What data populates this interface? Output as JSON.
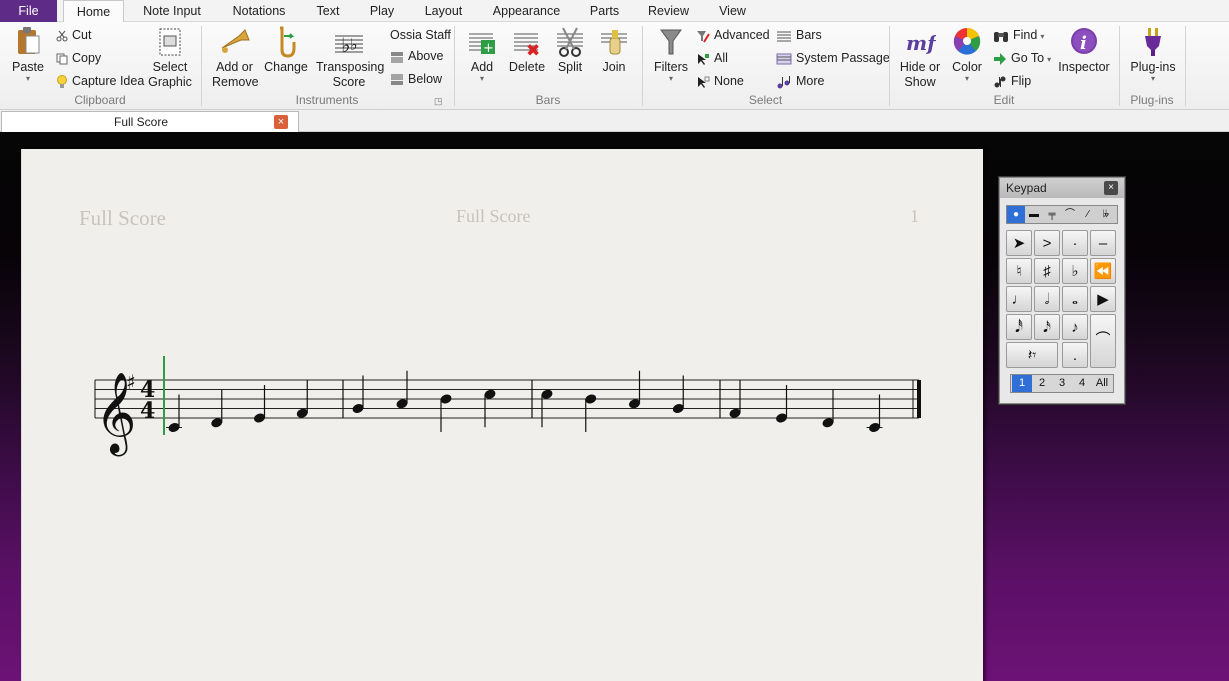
{
  "menu_tabs": [
    "File",
    "Home",
    "Note Input",
    "Notations",
    "Text",
    "Play",
    "Layout",
    "Appearance",
    "Parts",
    "Review",
    "View"
  ],
  "active_tab": "Home",
  "ribbon": {
    "clipboard": {
      "group_label": "Clipboard",
      "paste": "Paste",
      "cut": "Cut",
      "copy": "Copy",
      "capture_idea": "Capture Idea",
      "select_graphic": "Select Graphic"
    },
    "instruments": {
      "group_label": "Instruments",
      "add_or_remove": "Add or Remove",
      "change": "Change",
      "transposing_score": "Transposing Score",
      "ossia_staff": "Ossia Staff",
      "above": "Above",
      "below": "Below"
    },
    "bars": {
      "group_label": "Bars",
      "add": "Add",
      "delete": "Delete",
      "split": "Split",
      "join": "Join"
    },
    "select": {
      "group_label": "Select",
      "filters": "Filters",
      "advanced": "Advanced",
      "all": "All",
      "none": "None",
      "bars": "Bars",
      "system_passage": "System Passage",
      "more": "More"
    },
    "edit": {
      "group_label": "Edit",
      "hide_or_show": "Hide or Show",
      "color": "Color",
      "find": "Find",
      "go_to": "Go To",
      "flip": "Flip",
      "inspector": "Inspector"
    },
    "plugins": {
      "group_label": "Plug-ins",
      "plugins": "Plug-ins"
    }
  },
  "document_tab": {
    "label": "Full Score",
    "close": "×"
  },
  "score": {
    "header_left": "Full Score",
    "header_center": "Full Score",
    "page_number": "1",
    "clef": "treble",
    "key_signature": "G major (1 sharp)",
    "time_signature": "4/4",
    "bars": [
      {
        "notes": [
          "C4",
          "D4",
          "E4",
          "F#4"
        ]
      },
      {
        "notes": [
          "G4",
          "A4",
          "B4",
          "C5"
        ]
      },
      {
        "notes": [
          "C5",
          "B4",
          "A4",
          "G4"
        ]
      },
      {
        "notes": [
          "F#4",
          "E4",
          "D4",
          "C4"
        ]
      }
    ],
    "note_value": "quarter"
  },
  "keypad": {
    "title": "Keypad",
    "close": "×",
    "layouts": [
      "1",
      "2",
      "3",
      "4",
      "All"
    ],
    "active_layout": "1",
    "keys_row1": [
      "pointer",
      ">",
      "·",
      "–"
    ],
    "keys_row2": [
      "♮",
      "#",
      "♭",
      "rewind"
    ],
    "keys_row3": [
      "quarter",
      "half",
      "whole",
      "play"
    ],
    "keys_row4": [
      "32nd",
      "16th",
      "8th"
    ],
    "keys_row5": [
      "rest",
      "dot",
      "tie"
    ]
  },
  "colors": {
    "file_tab": "#5e2c87",
    "selection_line": "#2e9e46",
    "keypad_active": "#2f6fd6"
  }
}
